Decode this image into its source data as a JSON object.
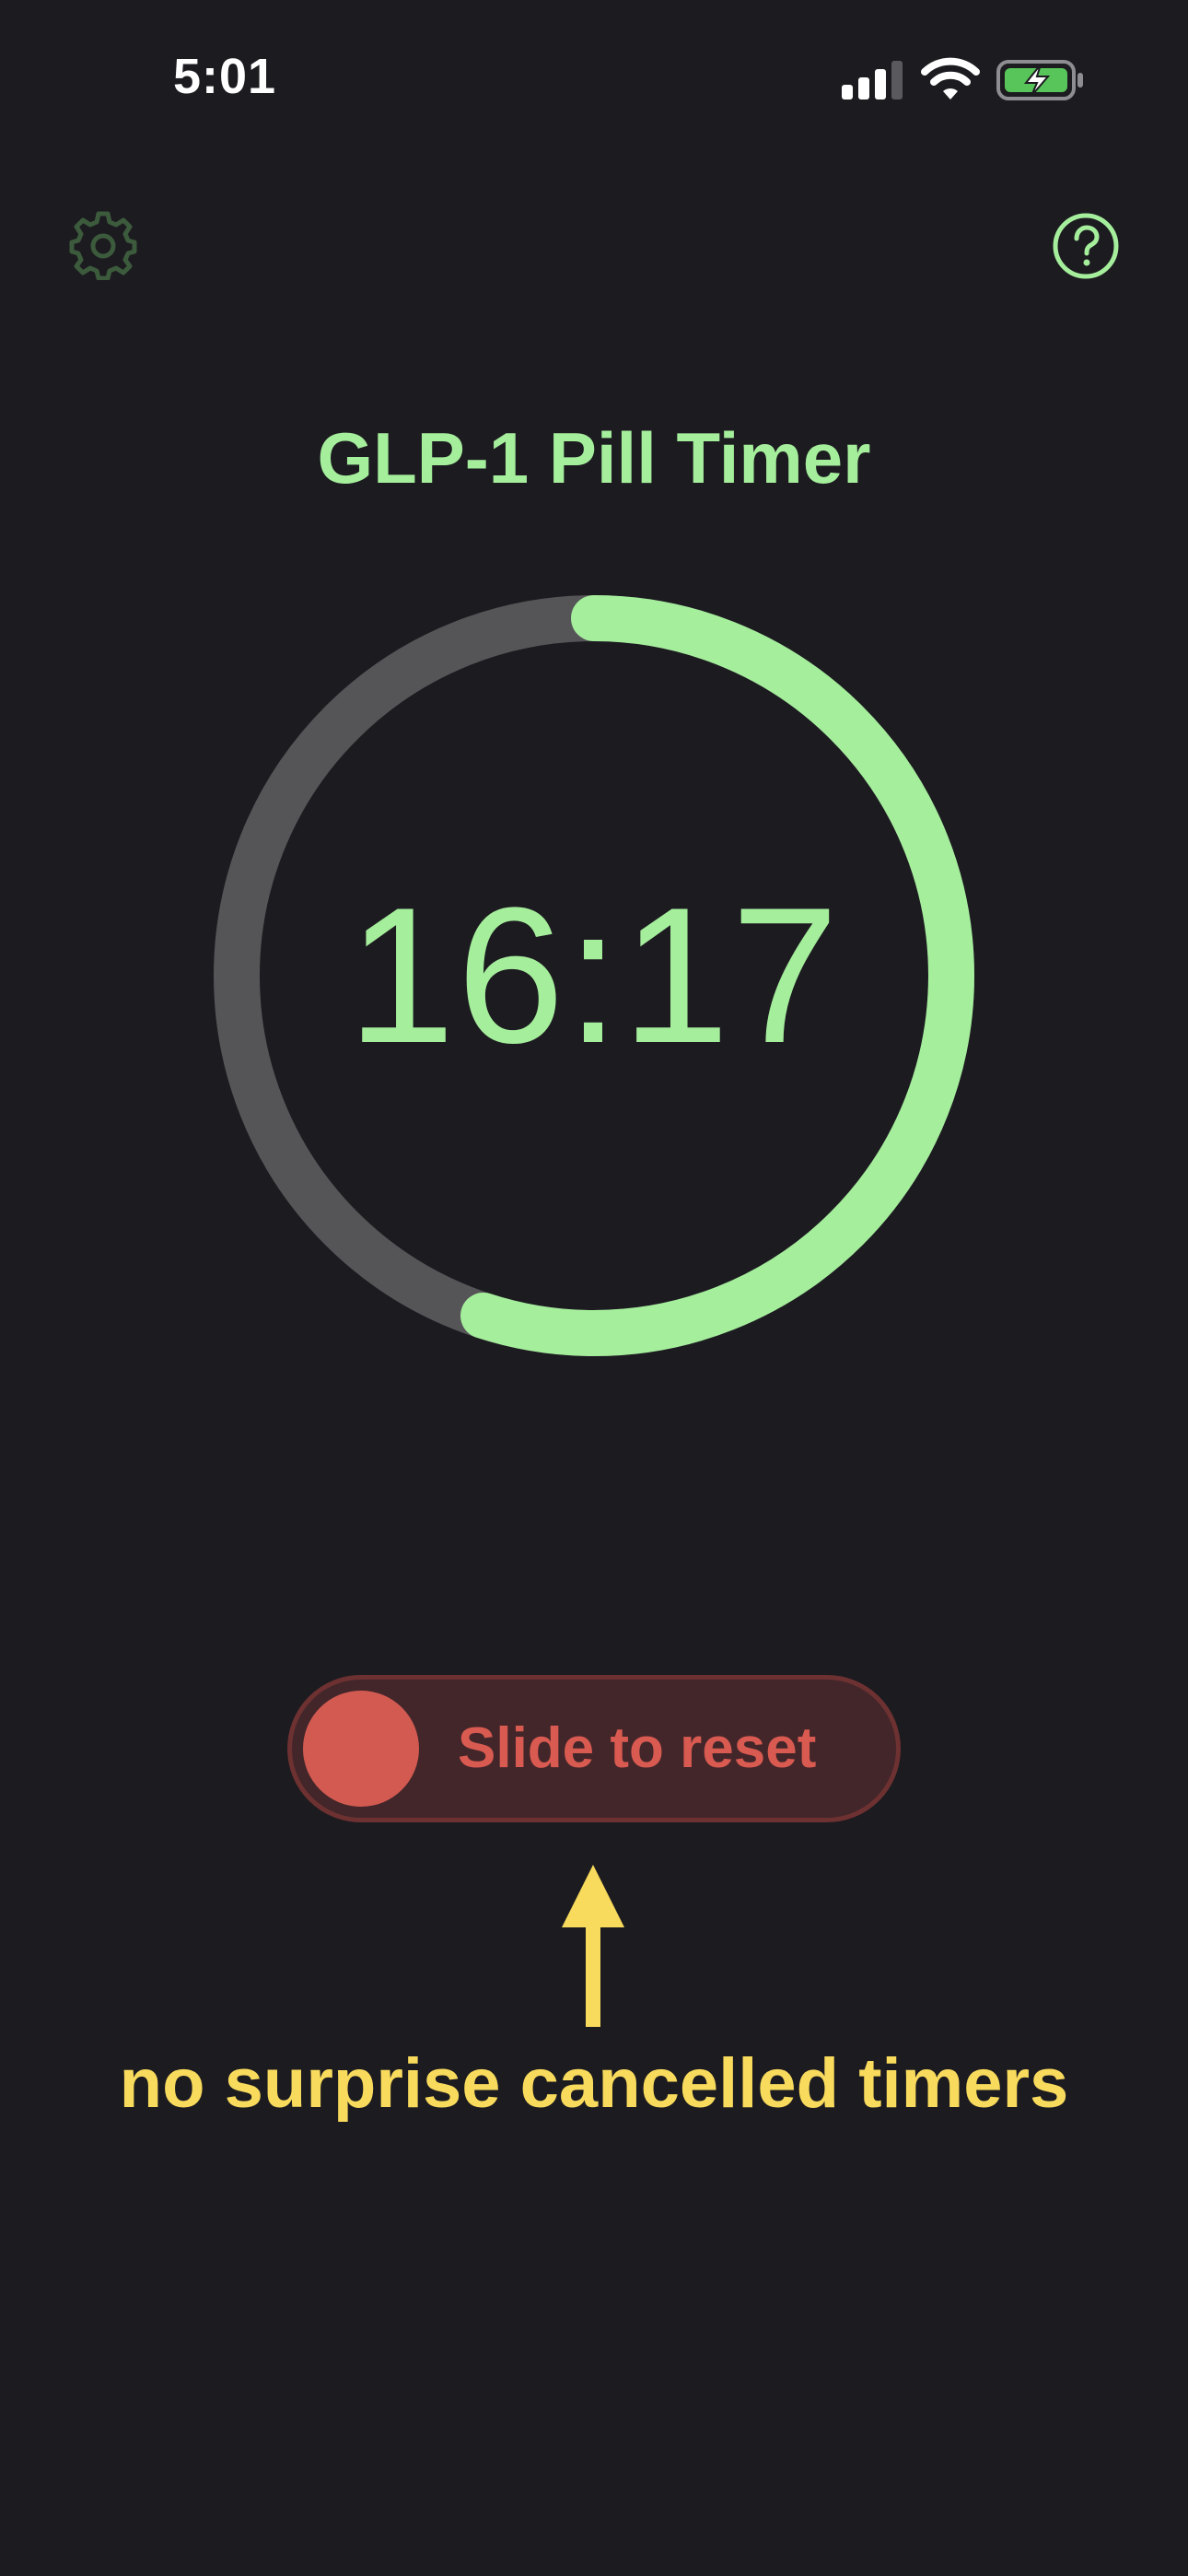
{
  "status_bar": {
    "time": "5:01",
    "icons": [
      "cellular-signal-icon",
      "wifi-icon",
      "battery-charging-icon"
    ]
  },
  "toolbar": {
    "settings_icon": "gear-icon",
    "help_icon": "question-circle-icon"
  },
  "title": "GLP-1 Pill Timer",
  "timer": {
    "display": "16:17",
    "progress_fraction": 0.55
  },
  "reset_slider": {
    "label": "Slide to reset"
  },
  "annotation": {
    "text": "no surprise cancelled timers"
  },
  "colors": {
    "background": "#1c1b20",
    "accent_green": "#a5ee9c",
    "ring_track": "#555558",
    "reset_red": "#d25a51",
    "annotation_yellow": "#f8da5c"
  }
}
